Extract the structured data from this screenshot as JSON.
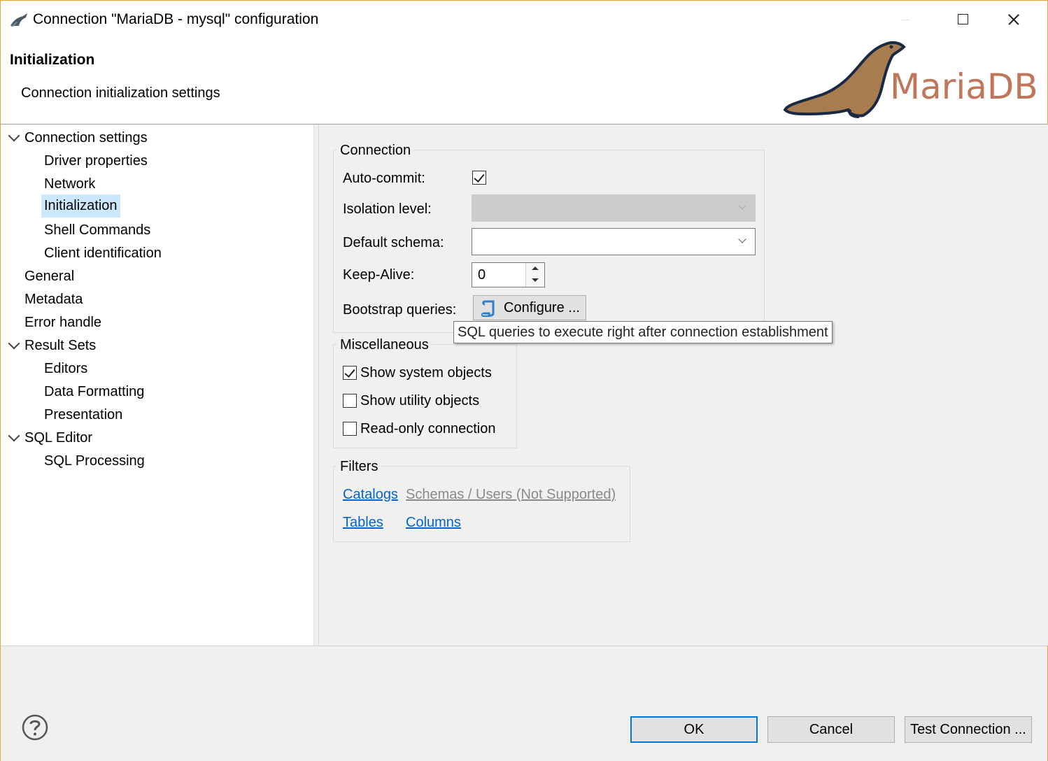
{
  "window": {
    "title": "Connection \"MariaDB - mysql\" configuration",
    "accent_color": "#e8a33d"
  },
  "header": {
    "title": "Initialization",
    "subtitle": "Connection initialization settings",
    "logo_text": "MariaDB",
    "logo_color": "#c0765a",
    "seal_color": "#a97c50"
  },
  "nav": {
    "selected_color": "#cce8ff",
    "items": [
      {
        "label": "Connection settings",
        "level": 0,
        "expanded": true
      },
      {
        "label": "Driver properties",
        "level": 1
      },
      {
        "label": "Network",
        "level": 1
      },
      {
        "label": "Initialization",
        "level": 1,
        "selected": true
      },
      {
        "label": "Shell Commands",
        "level": 1
      },
      {
        "label": "Client identification",
        "level": 1
      },
      {
        "label": "General",
        "level": 0
      },
      {
        "label": "Metadata",
        "level": 0
      },
      {
        "label": "Error handle",
        "level": 0
      },
      {
        "label": "Result Sets",
        "level": 0,
        "expanded": true
      },
      {
        "label": "Editors",
        "level": 1
      },
      {
        "label": "Data Formatting",
        "level": 1
      },
      {
        "label": "Presentation",
        "level": 1
      },
      {
        "label": "SQL Editor",
        "level": 0,
        "expanded": true
      },
      {
        "label": "SQL Processing",
        "level": 1
      }
    ]
  },
  "connection": {
    "title": "Connection",
    "autocommit_label": "Auto-commit:",
    "autocommit_checked": true,
    "isolation_label": "Isolation level:",
    "isolation_value": "",
    "default_schema_label": "Default schema:",
    "default_schema_value": "",
    "keepalive_label": "Keep-Alive:",
    "keepalive_value": "0",
    "bootstrap_label": "Bootstrap queries:",
    "configure_label": "Configure ..."
  },
  "tooltip": {
    "text": "SQL queries to execute right after connection establishment"
  },
  "misc": {
    "title": "Miscellaneous",
    "options": [
      {
        "label": "Show system objects",
        "checked": true
      },
      {
        "label": "Show utility objects",
        "checked": false
      },
      {
        "label": "Read-only connection",
        "checked": false
      }
    ]
  },
  "filters": {
    "title": "Filters",
    "catalogs": "Catalogs",
    "schemas": "Schemas / Users (Not Supported)",
    "tables": "Tables",
    "columns": "Columns",
    "link_color": "#0066cc"
  },
  "footer": {
    "ok_label": "OK",
    "cancel_label": "Cancel",
    "test_label": "Test Connection ..."
  }
}
